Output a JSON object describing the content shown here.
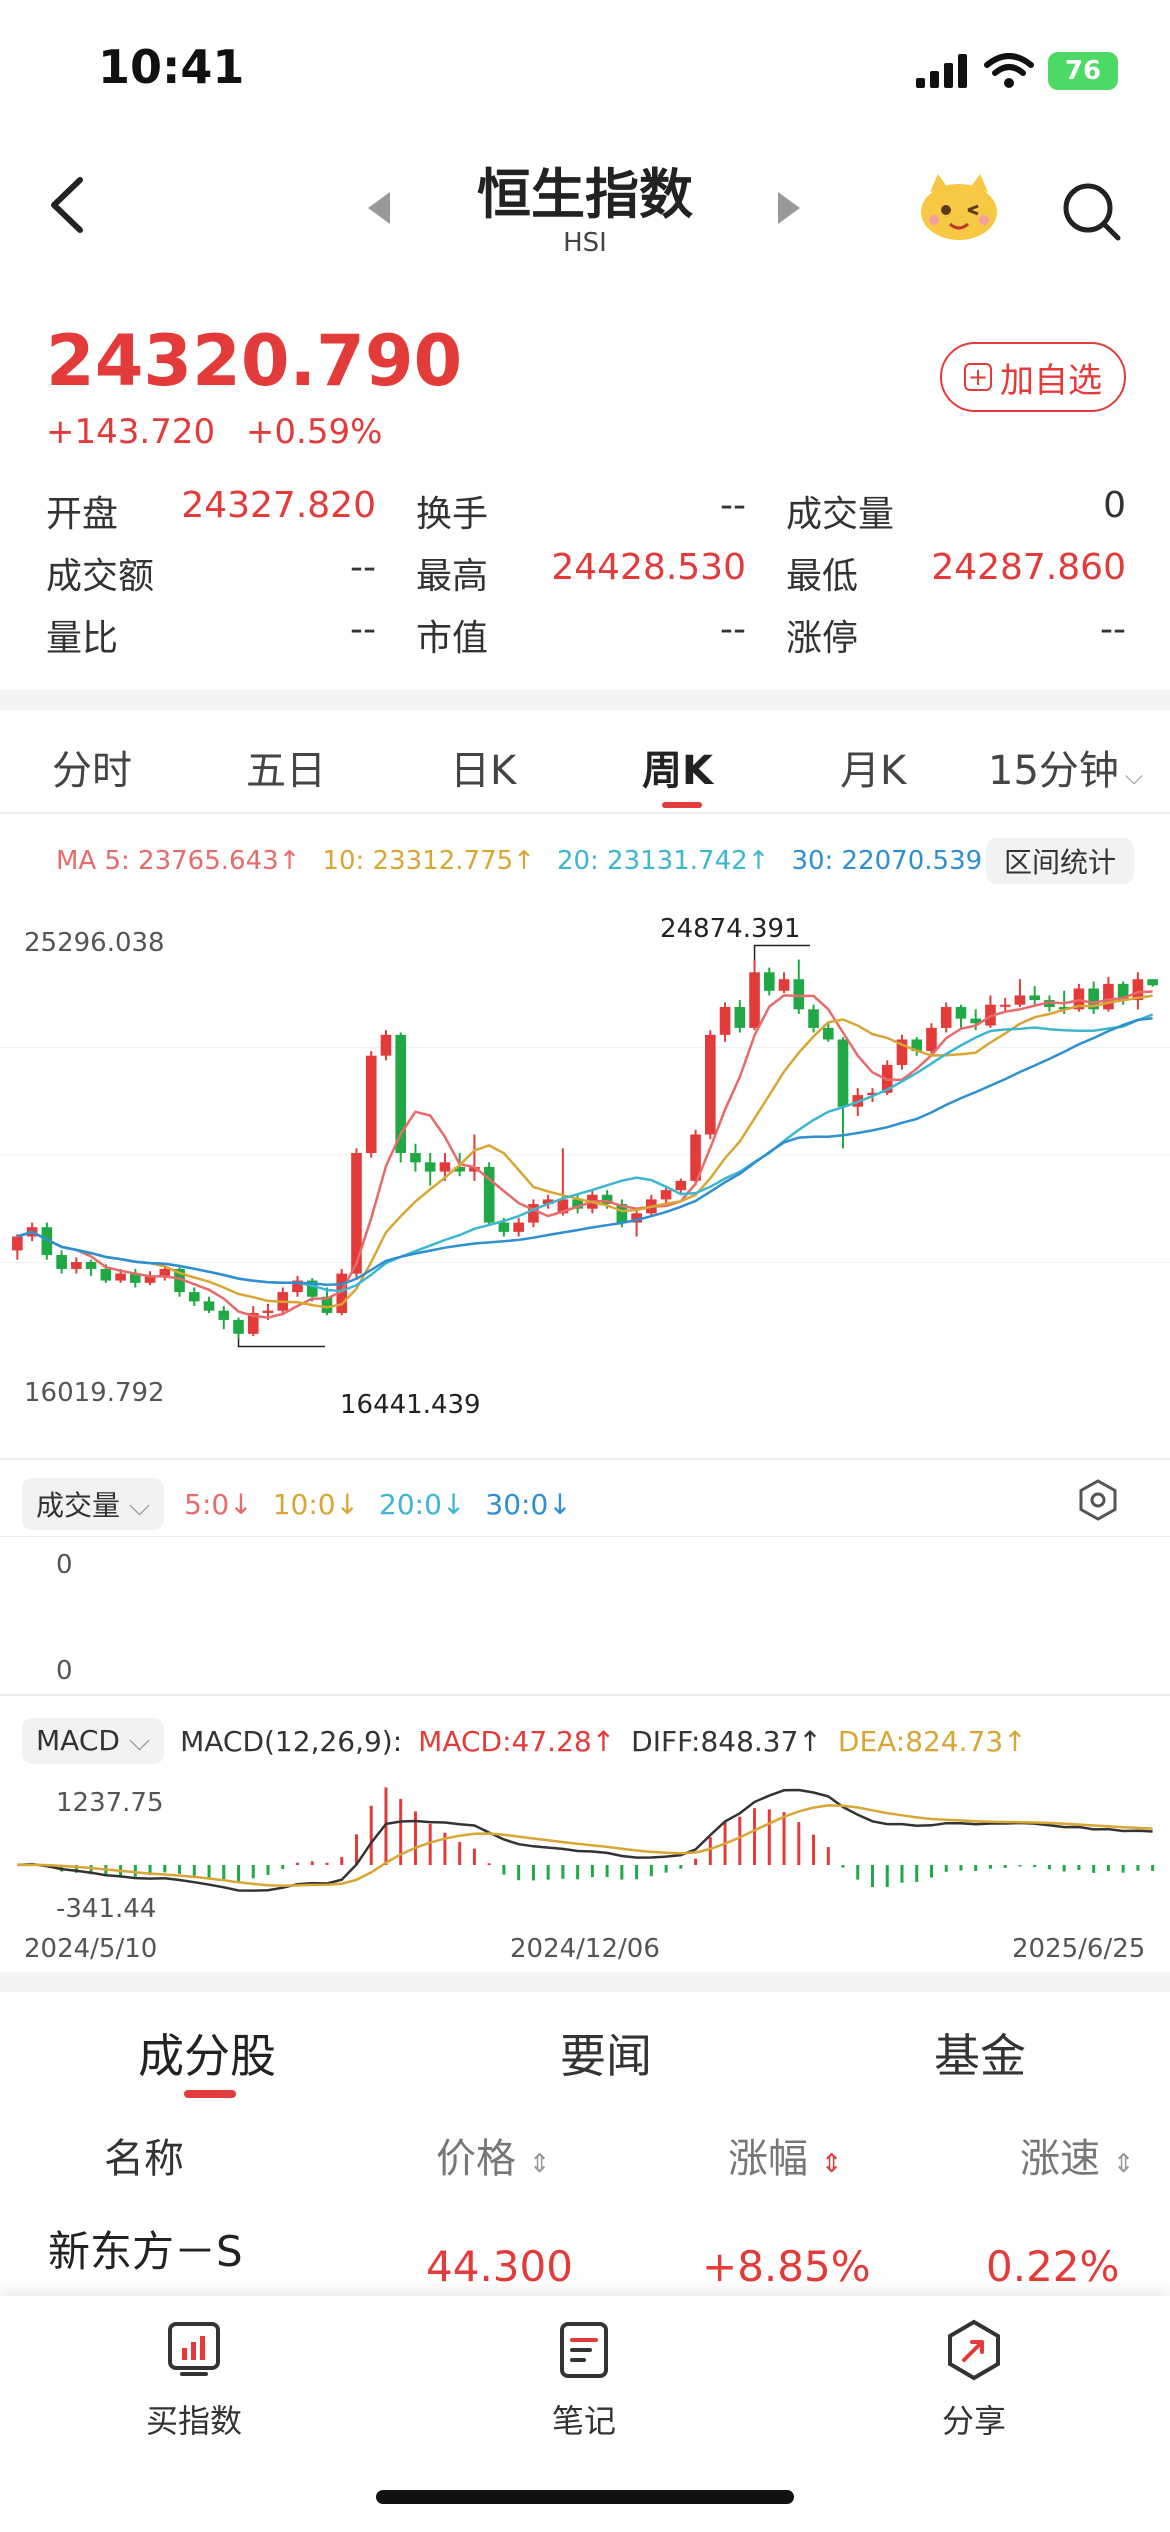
{
  "status": {
    "time": "10:41",
    "battery": "76"
  },
  "header": {
    "title": "恒生指数",
    "subtitle": "HSI"
  },
  "quote": {
    "price": "24320.790",
    "change": "+143.720",
    "change_pct": "+0.59%",
    "watch_label": "加自选",
    "stats": [
      [
        {
          "label": "开盘",
          "value": "24327.820",
          "red": true
        },
        {
          "label": "换手",
          "value": "--"
        },
        {
          "label": "成交量",
          "value": "0"
        }
      ],
      [
        {
          "label": "成交额",
          "value": "--"
        },
        {
          "label": "最高",
          "value": "24428.530",
          "red": true
        },
        {
          "label": "最低",
          "value": "24287.860",
          "red": true
        }
      ],
      [
        {
          "label": "量比",
          "value": "--"
        },
        {
          "label": "市值",
          "value": "--"
        },
        {
          "label": "涨停",
          "value": "--"
        }
      ]
    ]
  },
  "period_tabs": [
    "分时",
    "五日",
    "日K",
    "周K",
    "月K",
    "15分钟"
  ],
  "active_period": "周K",
  "ma": {
    "ma5": "MA 5: 23765.643↑",
    "ma10": "10: 23312.775↑",
    "ma20": "20: 23131.742↑",
    "ma30": "30: 22070.539↑",
    "range_label": "区间统计"
  },
  "colors": {
    "up": "#e33a3a",
    "down": "#1fa844",
    "ma5": "#e86a6a",
    "ma10": "#d9a534",
    "ma20": "#3db6cf",
    "ma30": "#2f8fd0"
  },
  "kline": {
    "y_top_label": "25296.038",
    "y_bottom_label": "16019.792",
    "high_label": "24874.391",
    "low_label": "16441.439"
  },
  "chart_data": {
    "type": "candlestick",
    "ylim": [
      16019.792,
      25296.038
    ],
    "candles": [
      [
        18600,
        18900,
        18400,
        18950
      ],
      [
        18900,
        19100,
        18800,
        19200
      ],
      [
        19100,
        18500,
        18400,
        19200
      ],
      [
        18500,
        18200,
        18100,
        18600
      ],
      [
        18200,
        18350,
        18100,
        18450
      ],
      [
        18350,
        18200,
        18050,
        18400
      ],
      [
        18200,
        17950,
        17900,
        18300
      ],
      [
        17950,
        18100,
        17900,
        18200
      ],
      [
        18100,
        17900,
        17800,
        18200
      ],
      [
        17900,
        18050,
        17850,
        18150
      ],
      [
        18050,
        18200,
        17950,
        18300
      ],
      [
        18200,
        17700,
        17600,
        18250
      ],
      [
        17700,
        17500,
        17400,
        17800
      ],
      [
        17500,
        17300,
        17250,
        17600
      ],
      [
        17300,
        17100,
        16900,
        17400
      ],
      [
        17100,
        16800,
        16700,
        17150
      ],
      [
        16800,
        17250,
        16750,
        17400
      ],
      [
        17250,
        17300,
        17100,
        17450
      ],
      [
        17300,
        17700,
        17250,
        17800
      ],
      [
        17700,
        17950,
        17600,
        18050
      ],
      [
        17950,
        17600,
        17500,
        18000
      ],
      [
        17600,
        17250,
        17200,
        17800
      ],
      [
        17250,
        18100,
        17200,
        18200
      ],
      [
        18100,
        20700,
        18000,
        20800
      ],
      [
        20700,
        22800,
        20600,
        22900
      ],
      [
        22800,
        23250,
        22700,
        23350
      ],
      [
        23250,
        20700,
        20500,
        23300
      ],
      [
        20700,
        20500,
        20300,
        20900
      ],
      [
        20500,
        20300,
        20000,
        20700
      ],
      [
        20300,
        20500,
        20100,
        20700
      ],
      [
        20400,
        20300,
        20200,
        20700
      ],
      [
        20300,
        20400,
        20100,
        21100
      ],
      [
        20400,
        19200,
        19150,
        20500
      ],
      [
        19200,
        19000,
        18900,
        19300
      ],
      [
        19000,
        19200,
        18900,
        19300
      ],
      [
        19200,
        19600,
        19100,
        19700
      ],
      [
        19600,
        19700,
        19500,
        19800
      ],
      [
        19400,
        19700,
        19350,
        20800
      ],
      [
        19700,
        19500,
        19400,
        19800
      ],
      [
        19500,
        19800,
        19400,
        19900
      ],
      [
        19800,
        19600,
        19500,
        19900
      ],
      [
        19600,
        19200,
        19100,
        19700
      ],
      [
        19200,
        19400,
        18900,
        19500
      ],
      [
        19400,
        19700,
        19350,
        19800
      ],
      [
        19700,
        19900,
        19600,
        20000
      ],
      [
        19900,
        20100,
        19800,
        20150
      ],
      [
        20100,
        21100,
        20000,
        21200
      ],
      [
        21100,
        23250,
        21000,
        23350
      ],
      [
        23250,
        23850,
        23100,
        23950
      ],
      [
        23850,
        23400,
        23300,
        24000
      ],
      [
        23400,
        24600,
        23350,
        24874.391
      ],
      [
        24600,
        24200,
        24100,
        24700
      ],
      [
        24200,
        24450,
        24150,
        24600
      ],
      [
        24450,
        23800,
        23700,
        24874.391
      ],
      [
        23800,
        23400,
        23300,
        23900
      ],
      [
        23400,
        23150,
        23100,
        23500
      ],
      [
        23150,
        21700,
        20800,
        23200
      ],
      [
        21700,
        21950,
        21500,
        22100
      ],
      [
        21950,
        22000,
        21800,
        22100
      ],
      [
        22000,
        22600,
        21950,
        22700
      ],
      [
        22600,
        23150,
        22500,
        23250
      ],
      [
        23150,
        22900,
        22800,
        23200
      ],
      [
        22900,
        23400,
        22850,
        23500
      ],
      [
        23400,
        23850,
        23300,
        23950
      ],
      [
        23850,
        23600,
        23400,
        23900
      ],
      [
        23600,
        23500,
        23350,
        23800
      ],
      [
        23450,
        23900,
        23400,
        24100
      ],
      [
        23900,
        23900,
        23750,
        24050
      ],
      [
        23900,
        24100,
        23850,
        24450
      ],
      [
        24100,
        24000,
        23900,
        24300
      ],
      [
        24000,
        23850,
        23750,
        24100
      ],
      [
        23850,
        23800,
        23700,
        24200
      ],
      [
        23800,
        24250,
        23750,
        24350
      ],
      [
        24250,
        23800,
        23700,
        24400
      ],
      [
        23800,
        24350,
        23750,
        24500
      ],
      [
        24350,
        24000,
        23900,
        24400
      ],
      [
        24000,
        24450,
        23800,
        24600
      ],
      [
        24450,
        24320.79,
        24287.86,
        24428.53
      ]
    ]
  },
  "volume": {
    "dropdown": "成交量",
    "ma5": "5:0↓",
    "ma10": "10:0↓",
    "ma20": "20:0↓",
    "ma30": "30:0↓",
    "axis_top": "0",
    "axis_bottom": "0"
  },
  "macd": {
    "dropdown": "MACD",
    "params": "MACD(12,26,9):",
    "macd": "MACD:47.28↑",
    "diff": "DIFF:848.37↑",
    "dea": "DEA:824.73↑",
    "y_top": "1237.75",
    "y_bottom": "-341.44"
  },
  "dates": {
    "start": "2024/5/10",
    "mid": "2024/12/06",
    "end": "2025/6/25"
  },
  "section_tabs": [
    "成分股",
    "要闻",
    "基金"
  ],
  "table": {
    "headers": [
      "名称",
      "价格",
      "涨幅",
      "涨速"
    ],
    "rows": [
      {
        "name": "新东方－S",
        "price": "44.300",
        "pct": "+8.85%",
        "speed": "0.22%"
      }
    ]
  },
  "bottom_bar": [
    "买指数",
    "笔记",
    "分享"
  ]
}
